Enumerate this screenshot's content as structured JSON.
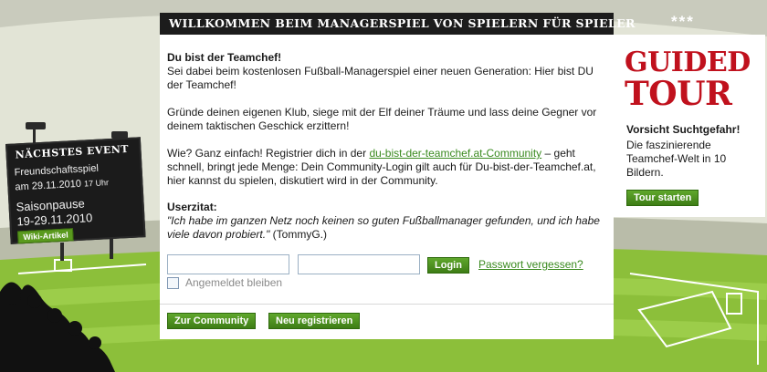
{
  "header": {
    "title": "WILLKOMMEN BEIM MANAGERSPIEL VON SPIELERN FÜR SPIELER",
    "stars": "***"
  },
  "intro": {
    "heading": "Du bist der Teamchef!",
    "p1": "Sei dabei beim kostenlosen Fußball-Managerspiel einer neuen Generation: Hier bist DU der Teamchef!",
    "p2": "Gründe deinen eigenen Klub, siege mit der Elf deiner Träume und lass deine Gegner vor deinem taktischen Geschick erzittern!",
    "p3_before": "Wie? Ganz einfach! Registrier dich in der ",
    "p3_link": "du-bist-der-teamchef.at-Community",
    "p3_after": " – geht schnell, bringt jede Menge: Dein Community-Login gilt auch für Du-bist-der-Teamchef.at, hier kannst du spielen, diskutiert wird in der Community."
  },
  "quote": {
    "heading": "Userzitat:",
    "text": "\"Ich habe im ganzen Netz noch keinen so guten Fußballmanager gefunden, und ich habe viele davon probiert.\"",
    "author": " (TommyG.)"
  },
  "login": {
    "username_value": "",
    "password_value": "",
    "button": "Login",
    "forgot": "Passwort vergessen?",
    "remember": "Angemeldet bleiben"
  },
  "footer_buttons": {
    "community": "Zur Community",
    "register": "Neu registrieren"
  },
  "scoreboard": {
    "heading": "NÄCHSTES EVENT",
    "event1_name": "Freundschaftsspiel",
    "event1_date": "am 29.11.2010",
    "event1_time": "17 Uhr",
    "event2_name": "Saisonpause",
    "event2_dates": "19-29.11.2010",
    "wiki": "Wiki-Artikel"
  },
  "tour": {
    "title_line1": "GUIDED",
    "title_line2": "TOUR",
    "subtitle": "Vorsicht Suchtgefahr!",
    "text": "Die faszinierende Teamchef-Welt in 10 Bildern.",
    "button": "Tour starten"
  },
  "colors": {
    "accent_green": "#4a8f20",
    "tour_red": "#c0111d",
    "header_black": "#1c1c1c",
    "pitch_green": "#8cbf3a"
  }
}
